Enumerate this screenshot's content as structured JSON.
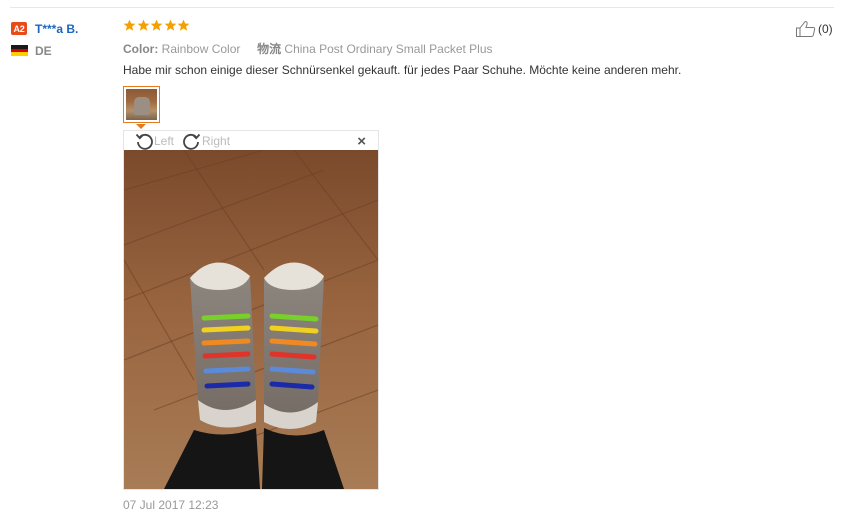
{
  "reviewer": {
    "level_badge": "A2",
    "name": "T***a B.",
    "country": "DE"
  },
  "review": {
    "rating": 5,
    "star_color": "#f4a000",
    "color_label": "Color:",
    "color_value": "Rainbow Color",
    "logistics_label": "物流",
    "logistics_value": "China Post Ordinary Small Packet Plus",
    "text": "Habe mir schon einige dieser Schnürsenkel gekauft. für jedes Paar Schuhe. Möchte keine anderen mehr.",
    "timestamp": "07 Jul 2017 12:23"
  },
  "viewer": {
    "rotate_left_label": "Left",
    "rotate_right_label": "Right",
    "close_label": "×"
  },
  "helpful": {
    "count": "(0)"
  },
  "colors": {
    "accent": "#e67a1e",
    "link": "#1a66c2",
    "badge": "#e84a1a"
  }
}
